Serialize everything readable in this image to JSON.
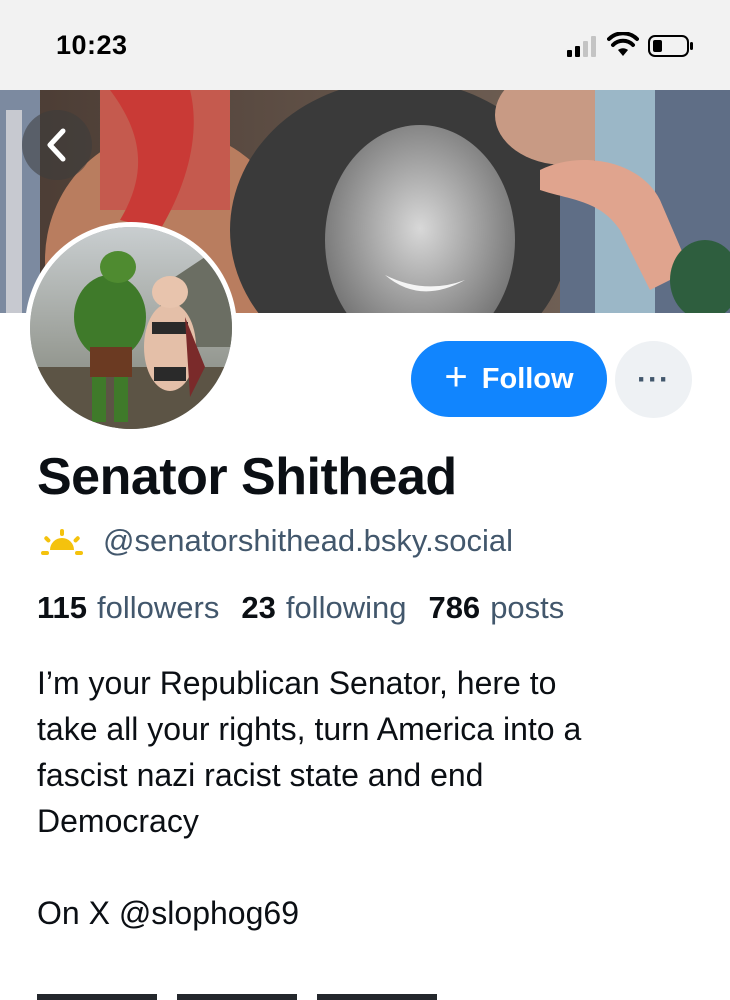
{
  "status_bar": {
    "time": "10:23",
    "icons": [
      "cellular-signal-icon",
      "wifi-icon",
      "battery-icon"
    ]
  },
  "header": {
    "back_icon": "chevron-left-icon"
  },
  "profile": {
    "display_name": "Senator Shithead",
    "handle": "@senatorshithead.bsky.social",
    "handle_badge_icon": "sunrise-icon",
    "follow_label": "Follow",
    "follow_icon": "plus-icon",
    "more_icon": "ellipsis-icon",
    "more_label": "···"
  },
  "stats": {
    "followers_count": "115",
    "followers_label": "followers",
    "following_count": "23",
    "following_label": "following",
    "posts_count": "786",
    "posts_label": "posts"
  },
  "bio": {
    "text": "I’m your Republican Senator, here to\ntake all your rights, turn America into a\nfascist nazi racist state and end\nDemocracy\n\nOn X @slophog69"
  },
  "colors": {
    "accent": "#1185fe",
    "secondary_text": "#42576c",
    "primary_text": "#0b0f14",
    "more_button_bg": "#eef1f4",
    "badge_yellow": "#f4c20d"
  }
}
